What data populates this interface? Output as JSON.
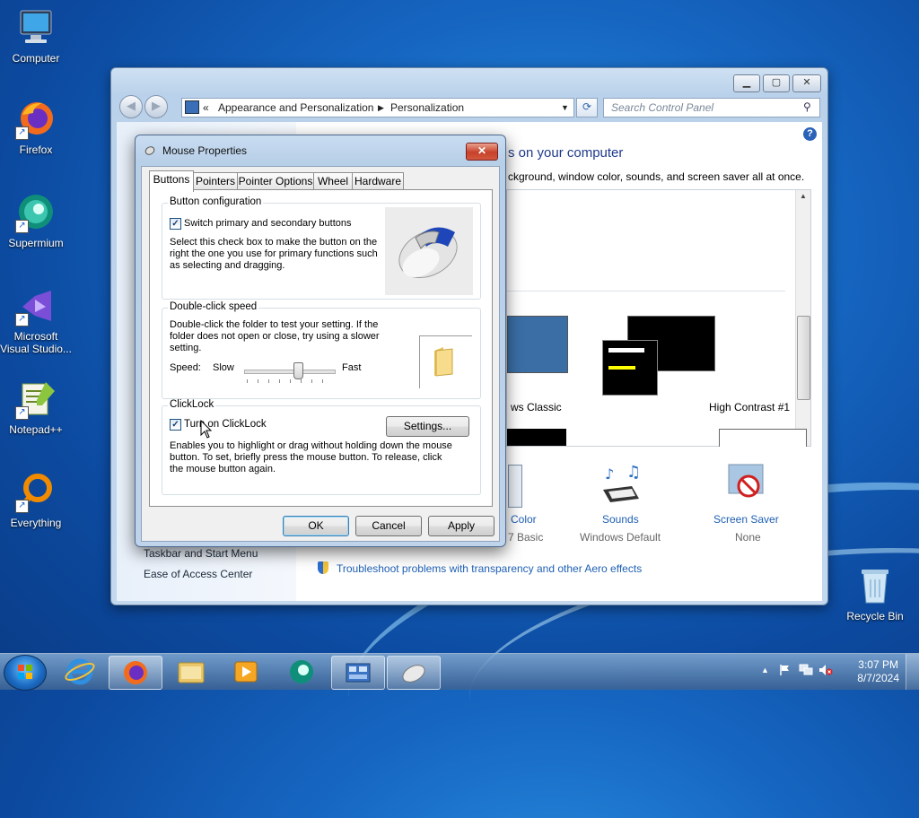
{
  "desktop": {
    "icons": [
      {
        "label": "Computer",
        "icon": "computer-icon"
      },
      {
        "label": "Firefox",
        "icon": "firefox-icon"
      },
      {
        "label": "Supermium",
        "icon": "supermium-icon"
      },
      {
        "label": "Microsoft Visual Studio...",
        "line1": "Microsoft",
        "line2": "Visual Studio...",
        "icon": "visual-studio-icon"
      },
      {
        "label": "Notepad++",
        "icon": "notepadpp-icon"
      },
      {
        "label": "Everything",
        "icon": "everything-icon"
      },
      {
        "label": "Recycle Bin",
        "icon": "recycle-bin-icon"
      }
    ]
  },
  "control_panel": {
    "breadcrumb": [
      "Appearance and Personalization",
      "Personalization"
    ],
    "breadcrumb_prefix": "«",
    "search_placeholder": "Search Control Panel",
    "heading_partial": "s on your computer",
    "subtitle_partial": "ckground, window color, sounds, and screen saver all at once.",
    "themes": [
      {
        "label": "ws Classic"
      },
      {
        "label": "High Contrast #1"
      }
    ],
    "bottom_items": [
      {
        "label": "Color",
        "sub": "7 Basic"
      },
      {
        "label": "Sounds",
        "sub": "Windows Default"
      },
      {
        "label": "Screen Saver",
        "sub": "None"
      }
    ],
    "left_links": [
      "Taskbar and Start Menu",
      "Ease of Access Center"
    ],
    "troubleshoot_link": "Troubleshoot problems with transparency and other Aero effects"
  },
  "dialog": {
    "title": "Mouse Properties",
    "close_glyph": "✕",
    "tabs": [
      "Buttons",
      "Pointers",
      "Pointer Options",
      "Wheel",
      "Hardware"
    ],
    "active_tab": "Buttons",
    "button_config": {
      "title": "Button configuration",
      "checkbox_label": "Switch primary and secondary buttons",
      "checked": true,
      "description": "Select this check box to make the button on the right the one you use for primary functions such as selecting and dragging."
    },
    "double_click": {
      "title": "Double-click speed",
      "description": "Double-click the folder to test your setting. If the folder does not open or close, try using a slower setting.",
      "speed_label": "Speed:",
      "slow_label": "Slow",
      "fast_label": "Fast",
      "slider_value_fraction": 0.6
    },
    "clicklock": {
      "title": "ClickLock",
      "checkbox_label": "Turn on ClickLock",
      "checked": true,
      "settings_button": "Settings...",
      "description": "Enables you to highlight or drag without holding down the mouse button. To set, briefly press the mouse button. To release, click the mouse button again."
    },
    "buttons": {
      "ok": "OK",
      "cancel": "Cancel",
      "apply": "Apply"
    }
  },
  "taskbar": {
    "apps": [
      "internet-explorer-icon",
      "firefox-icon",
      "explorer-icon",
      "media-player-icon",
      "supermium-icon",
      "control-panel-icon",
      "mouse-icon"
    ],
    "time": "3:07 PM",
    "date": "8/7/2024"
  },
  "colors": {
    "link": "#1e5fb4",
    "desktop": "#1667c2",
    "high_contrast_yellow": "#ffff00"
  }
}
